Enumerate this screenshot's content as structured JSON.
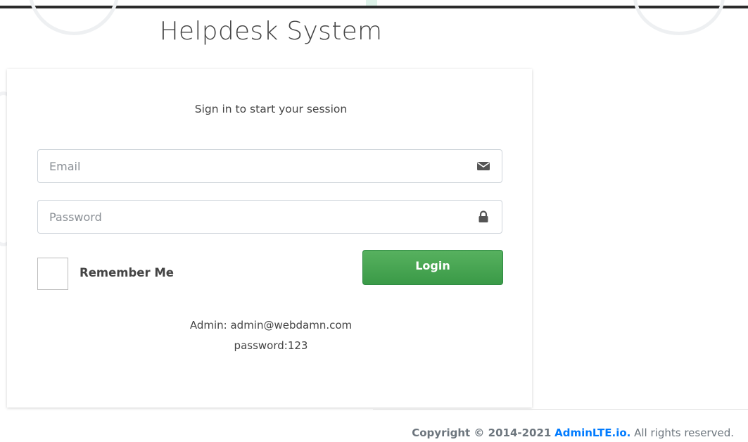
{
  "app": {
    "title": "Helpdesk System"
  },
  "login": {
    "subtitle": "Sign in to start your session",
    "email_placeholder": "Email",
    "email_value": "",
    "password_placeholder": "Password",
    "password_value": "",
    "remember_label": "Remember Me",
    "remember_checked": false,
    "login_label": "Login",
    "email_icon": "envelope-icon",
    "password_icon": "lock-icon"
  },
  "credentials": {
    "line1": "Admin: admin@webdamn.com",
    "line2": "password:123"
  },
  "footer": {
    "copyright": "Copyright © 2014-2021",
    "link": "AdminLTE.io.",
    "rights": "All rights reserved."
  },
  "colors": {
    "login_button": "#3f9e4a",
    "link": "#007bff"
  }
}
